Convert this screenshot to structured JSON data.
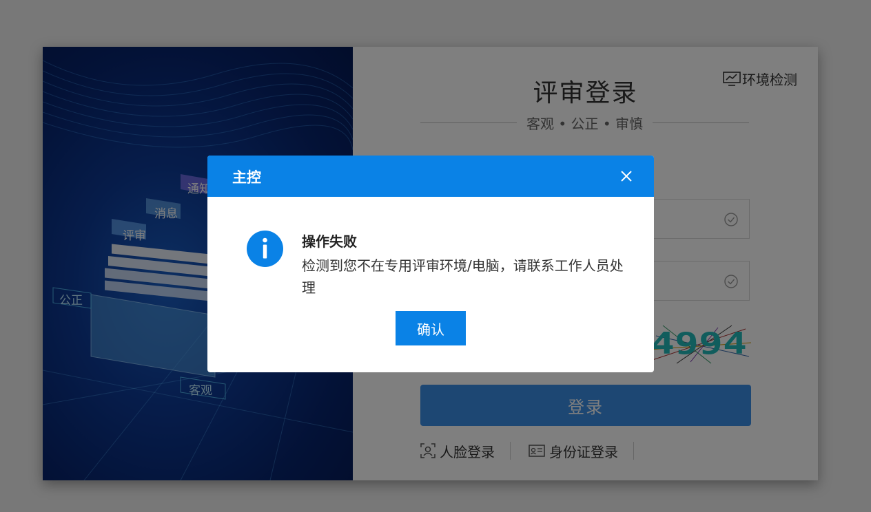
{
  "illustration": {
    "labels": [
      "通知",
      "消息",
      "评审",
      "公正",
      "客观"
    ]
  },
  "login": {
    "env_check_label": "环境检测",
    "title": "评审登录",
    "subtitle": "客观 • 公正 • 审慎",
    "captcha_text": "4994",
    "login_button": "登录",
    "face_login": "人脸登录",
    "id_login": "身份证登录"
  },
  "dialog": {
    "title": "主控",
    "message_title": "操作失败",
    "message_body": "检测到您不在专用评审环境/电脑，请联系工作人员处理",
    "confirm_label": "确认"
  },
  "colors": {
    "primary": "#0a82e6",
    "login_button": "#3a8ee6",
    "illustration_dark": "#051a55",
    "overlay": "rgba(0,0,0,0.5)"
  }
}
